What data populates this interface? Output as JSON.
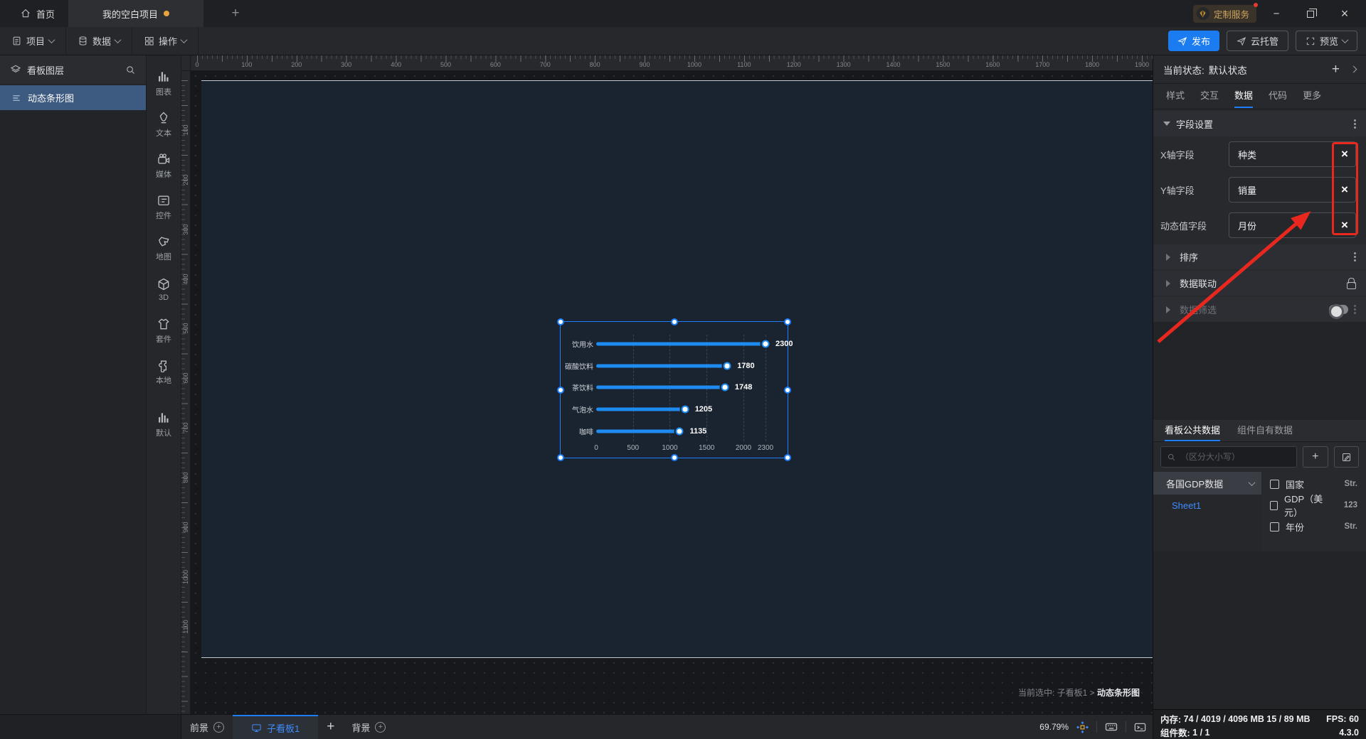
{
  "titlebar": {
    "home_tab": "首页",
    "project_tab": "我的空白项目",
    "custom_service": "定制服务"
  },
  "menubar": {
    "items": [
      {
        "label": "项目"
      },
      {
        "label": "数据"
      },
      {
        "label": "操作"
      }
    ],
    "publish": "发布",
    "cloud_host": "云托管",
    "preview": "预览"
  },
  "layers_panel": {
    "title": "看板图层",
    "items": [
      {
        "label": "动态条形图"
      }
    ]
  },
  "component_strip": [
    "图表",
    "文本",
    "媒体",
    "控件",
    "地图",
    "3D",
    "套件",
    "本地",
    "默认"
  ],
  "canvas": {
    "h_ruler_labels": [
      0,
      100,
      200,
      300,
      400,
      500,
      600,
      700,
      800,
      900,
      1000,
      1100,
      1200,
      1300,
      1400,
      1500,
      1600,
      1700,
      1800,
      1900
    ],
    "v_ruler_labels": [
      100,
      200,
      300,
      400,
      500,
      600,
      700,
      800,
      900,
      1000,
      1100
    ],
    "selected_hint_prefix": "当前选中: 子看板1 >",
    "selected_hint_target": "动态条形图"
  },
  "chart_data": {
    "type": "bar",
    "orientation": "horizontal",
    "title": "",
    "xlabel": "",
    "ylabel": "",
    "categories": [
      "饮用水",
      "碳酸饮料",
      "茶饮料",
      "气泡水",
      "咖啡"
    ],
    "values": [
      2300,
      1780,
      1748,
      1205,
      1135
    ],
    "x_ticks": [
      0,
      500,
      1000,
      1500,
      2000,
      2300
    ],
    "xlim": [
      0,
      2300
    ],
    "grid": "dashed-vertical",
    "bar_color": "#1d8bf0",
    "value_label_color": "#ffffff"
  },
  "inspector": {
    "state_label": "当前状态:",
    "state_value": "默认状态",
    "tabs": [
      "样式",
      "交互",
      "数据",
      "代码",
      "更多"
    ],
    "active_tab": "数据",
    "field_section_title": "字段设置",
    "fields": [
      {
        "label": "X轴字段",
        "value": "种类"
      },
      {
        "label": "Y轴字段",
        "value": "销量"
      },
      {
        "label": "动态值字段",
        "value": "月份"
      }
    ],
    "sections": [
      {
        "title": "排序"
      },
      {
        "title": "数据联动"
      },
      {
        "title": "数据筛选"
      }
    ],
    "data_tabs": [
      "看板公共数据",
      "组件自有数据"
    ],
    "active_data_tab": "看板公共数据",
    "search_placeholder": "（区分大小写）",
    "dataset_name": "各国GDP数据",
    "dataset_sheet": "Sheet1",
    "dataset_fields": [
      {
        "name": "国家",
        "type": "Str."
      },
      {
        "name": "GDP（美元）",
        "type": "123"
      },
      {
        "name": "年份",
        "type": "Str."
      }
    ]
  },
  "bottombar": {
    "foreground": "前景",
    "board_tab": "子看板1",
    "background": "背景",
    "zoom": "69.79%"
  },
  "statusbar": {
    "memory_label": "内存:",
    "memory_value": "74 / 4019 / 4096 MB  15 / 89 MB",
    "fps_label": "FPS:",
    "fps_value": "60",
    "component_label": "组件数:",
    "component_value": "1 / 1",
    "version": "4.3.0"
  },
  "colors": {
    "accent": "#1d7dfa",
    "bar": "#1d8bf0",
    "annotation": "#e8281e",
    "selected_layer": "#3d5a80",
    "unsaved_dot": "#e8a33d",
    "badge_text": "#cfa45f"
  }
}
